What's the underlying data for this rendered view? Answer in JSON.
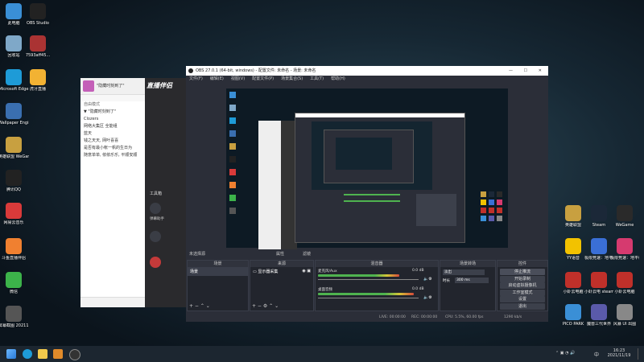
{
  "desktop_left": [
    {
      "name": "this-pc",
      "label": "此电脑",
      "color": "#3a8fd6"
    },
    {
      "name": "recycle-bin",
      "label": "回收站",
      "color": "#7fa8c8"
    },
    {
      "name": "edge",
      "label": "Microsoft Edge",
      "color": "#1e9bd7"
    },
    {
      "name": "wallpaper-engine",
      "label": "Wallpaper Engine",
      "color": "#3a6fb0"
    },
    {
      "name": "wegame",
      "label": "英雄联盟 WeGame版",
      "color": "#c8a040"
    },
    {
      "name": "qq",
      "label": "腾讯QQ",
      "color": "#222"
    },
    {
      "name": "netease-music",
      "label": "网易云音乐",
      "color": "#d93a3a"
    },
    {
      "name": "live-helper",
      "label": "斗鱼直播伴侣",
      "color": "#f08030"
    },
    {
      "name": "wechat",
      "label": "微信",
      "color": "#3cb34a"
    },
    {
      "name": "screenshot",
      "label": "屏幕截图 2021111...",
      "color": "#555"
    }
  ],
  "desktop_col2": [
    {
      "name": "obs-studio",
      "label": "OBS Studio",
      "color": "#222"
    },
    {
      "name": "file-7593",
      "label": "7593aff45...",
      "color": "#aa3333"
    },
    {
      "name": "huya-live",
      "label": "虎牙直播",
      "color": "#f2b233"
    }
  ],
  "desktop_right": [
    {
      "name": "lol",
      "label": "英雄联盟",
      "color": "#c8a040"
    },
    {
      "name": "steam",
      "label": "Steam",
      "color": "#1b2838"
    },
    {
      "name": "wegame-r",
      "label": "WeGame",
      "color": "#2a2a2a"
    },
    {
      "name": "yy-voice",
      "label": "YY语音",
      "color": "#f2c200"
    },
    {
      "name": "jijia",
      "label": "极限竞速：地平线 4",
      "color": "#3a6fd6"
    },
    {
      "name": "forza",
      "label": "极限竞速：地平线 5",
      "color": "#d63a6f"
    },
    {
      "name": "remote1",
      "label": "小虾云电脑",
      "color": "#c0302a"
    },
    {
      "name": "remote2",
      "label": "小虾云电 steam",
      "color": "#c0302a"
    },
    {
      "name": "remote3",
      "label": "小虾云电脑",
      "color": "#c0302a"
    },
    {
      "name": "pico",
      "label": "PICO PARK",
      "color": "#3a8fd6"
    },
    {
      "name": "uplay",
      "label": "魔兽三代世界",
      "color": "#5a5aaa"
    },
    {
      "name": "wallpaper-ui",
      "label": "风暴 UI 出图",
      "color": "#888"
    }
  ],
  "chat": {
    "group_title": "\"隐藏时刻到了\"",
    "section": "自由模式",
    "rows": [
      "▼ \"隐藏时刻到了\"",
      "Clozers",
      "网络大集区  全能组",
      "蓝天",
      "钱之天天, 网叶喜喜",
      "是否有最小帐一帆的生日为",
      "随意单单, 侬侬乐乐, 平顺安顺"
    ]
  },
  "live_panel": {
    "brand": "直播伴侣",
    "tools_label": "工具箱",
    "items": [
      "弹幕助手",
      "录制",
      "开播"
    ]
  },
  "obs": {
    "title": "OBS 27.0.1 (64-bit, windows) - 配置文件: 未命名 - 场景: 未命名",
    "menu": [
      "文件(F)",
      "编辑(E)",
      "视图(V)",
      "配置文件(P)",
      "场景集合(S)",
      "工具(T)",
      "帮助(H)"
    ],
    "status_line": "未选择源",
    "props_label": "属性",
    "filters_label": "滤镜",
    "docks": {
      "scenes": {
        "title": "场景",
        "items": [
          "场景"
        ]
      },
      "sources": {
        "title": "来源",
        "items": [
          "显示器采集"
        ]
      },
      "mixer": {
        "title": "混音器",
        "tracks": [
          {
            "name": "麦克风/Aux",
            "db": "0.0 dB",
            "level": 0.72
          },
          {
            "name": "桌面音频",
            "db": "0.0 dB",
            "level": 0.85
          }
        ]
      },
      "transitions": {
        "title": "场景转场",
        "type": "淡出",
        "duration_label": "时长",
        "duration": "300 ms"
      },
      "controls": {
        "title": "控件",
        "buttons": [
          "停止推流",
          "开始录制",
          "启动虚拟摄像机",
          "工作室模式",
          "设置",
          "退出"
        ]
      }
    },
    "statusbar": {
      "live": "LIVE: 00:00:00",
      "rec": "REC: 00:00:00",
      "cpu": "CPU: 5.5%, 60.00 fps",
      "kbps": "1290 kb/s"
    }
  },
  "taskbar": {
    "time": "16:23",
    "date": "2021/11/19",
    "lang": "中"
  }
}
